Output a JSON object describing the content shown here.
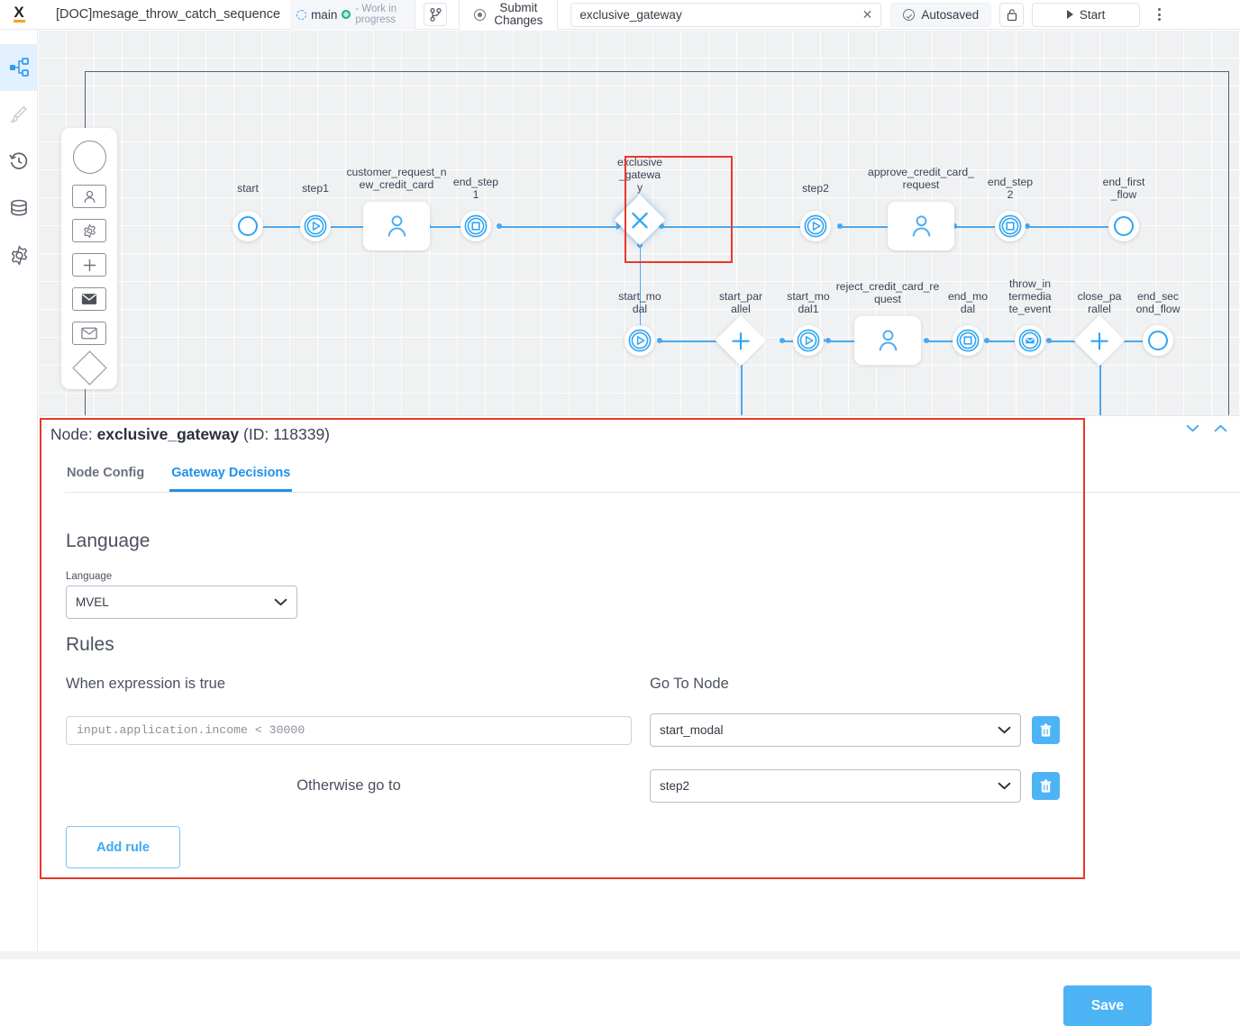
{
  "topbar": {
    "logo": "X",
    "doc_title": "[DOC]mesage_throw_catch_sequence",
    "branch_name": "main",
    "branch_status": "- Work in progress",
    "submit_changes": "Submit\nChanges",
    "node_search_value": "exclusive_gateway",
    "autosaved": "Autosaved",
    "start": "Start"
  },
  "rail": {
    "items": [
      {
        "name": "workflow-icon"
      },
      {
        "name": "brush-icon"
      },
      {
        "name": "history-icon"
      },
      {
        "name": "database-icon"
      },
      {
        "name": "settings-icon"
      }
    ]
  },
  "palette": {
    "items": [
      {
        "name": "start-event-shape"
      },
      {
        "name": "user-task-shape"
      },
      {
        "name": "service-task-shape"
      },
      {
        "name": "parallel-gateway-shape"
      },
      {
        "name": "send-message-shape"
      },
      {
        "name": "receive-message-shape"
      },
      {
        "name": "exclusive-gateway-shape"
      }
    ]
  },
  "diagram": {
    "nodes": [
      {
        "id": "start",
        "label": "start",
        "type": "start-event"
      },
      {
        "id": "step1",
        "label": "step1",
        "type": "intermediate-event"
      },
      {
        "id": "cust_req",
        "label": "customer_request_n\new_credit_card",
        "type": "user-task"
      },
      {
        "id": "end_step_1",
        "label": "end_step\n1",
        "type": "end-event"
      },
      {
        "id": "exclusive_gw",
        "label": "exclusive\n_gatewa\ny",
        "type": "exclusive-gateway"
      },
      {
        "id": "step2",
        "label": "step2",
        "type": "intermediate-event"
      },
      {
        "id": "approve_req",
        "label": "approve_credit_card_\nrequest",
        "type": "user-task"
      },
      {
        "id": "end_step_2",
        "label": "end_step\n2",
        "type": "end-event"
      },
      {
        "id": "end_first_flow",
        "label": "end_first\n_flow",
        "type": "end-circle"
      },
      {
        "id": "start_modal",
        "label": "start_mo\ndal",
        "type": "intermediate-event"
      },
      {
        "id": "start_parallel",
        "label": "start_par\nallel",
        "type": "parallel-gateway"
      },
      {
        "id": "start_modal1",
        "label": "start_mo\ndal1",
        "type": "intermediate-event"
      },
      {
        "id": "reject_req",
        "label": "reject_credit_card_re\nquest",
        "type": "user-task"
      },
      {
        "id": "end_modal",
        "label": "end_mo\ndal",
        "type": "end-event"
      },
      {
        "id": "throw_event",
        "label": "throw_in\ntermedia\nte_event",
        "type": "message-event"
      },
      {
        "id": "close_parallel",
        "label": "close_pa\nrallel",
        "type": "parallel-gateway"
      },
      {
        "id": "end_second",
        "label": "end_sec\nond_flow",
        "type": "end-circle"
      }
    ]
  },
  "panel": {
    "title_prefix": "Node: ",
    "node_name": "exclusive_gateway",
    "title_suffix": " (ID: 118339)",
    "tabs": [
      {
        "label": "Node Config",
        "active": false
      },
      {
        "label": "Gateway Decisions",
        "active": true
      }
    ],
    "language_section": {
      "heading": "Language",
      "field_label": "Language",
      "value": "MVEL"
    },
    "rules_section": {
      "heading": "Rules",
      "col_expression": "When expression is true",
      "col_goto": "Go To Node",
      "otherwise_label": "Otherwise go to",
      "rows": [
        {
          "expression": "input.application.income < 30000",
          "goto": "start_modal"
        }
      ],
      "default_goto": "step2",
      "add_rule": "Add rule"
    },
    "save": "Save"
  },
  "colors": {
    "accent": "#4cb3f5",
    "tab_active": "#2190e8",
    "flow_blue": "#4aa8f0",
    "highlight_red": "#e8392a",
    "logo_orange": "#f5a623",
    "green": "#21b07b"
  }
}
